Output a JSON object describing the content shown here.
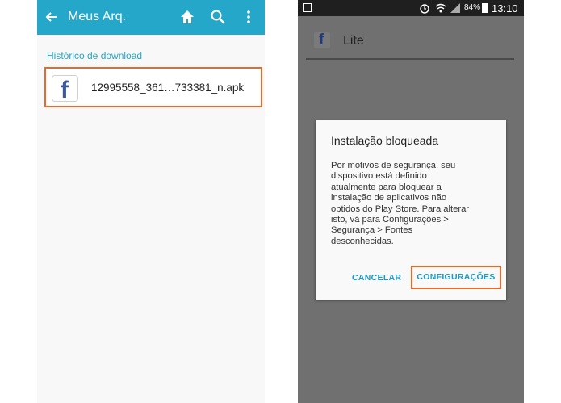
{
  "left": {
    "appbar": {
      "title": "Meus Arq."
    },
    "section_label": "Histórico de download",
    "file": {
      "name": "12995558_361…733381_n.apk",
      "icon": "facebook-icon"
    }
  },
  "right": {
    "statusbar": {
      "battery": "84%",
      "time": "13:10"
    },
    "app": {
      "title": "Lite",
      "icon": "facebook-lite-icon"
    },
    "dialog": {
      "title": "Instalação bloqueada",
      "body_lines": [
        "Por motivos de segurança, seu",
        "dispositivo está definido",
        "atualmente para bloquear a",
        "instalação de aplicativos não",
        "obtidos do Play Store. Para alterar",
        "isto, vá para Configurações >",
        "Segurança > Fontes",
        "desconhecidas."
      ],
      "cancel_label": "CANCELAR",
      "settings_label": "CONFIGURAÇÕES"
    }
  },
  "colors": {
    "accent": "#24a7c9",
    "highlight": "#e8692a",
    "link": "#1f9bc2"
  }
}
